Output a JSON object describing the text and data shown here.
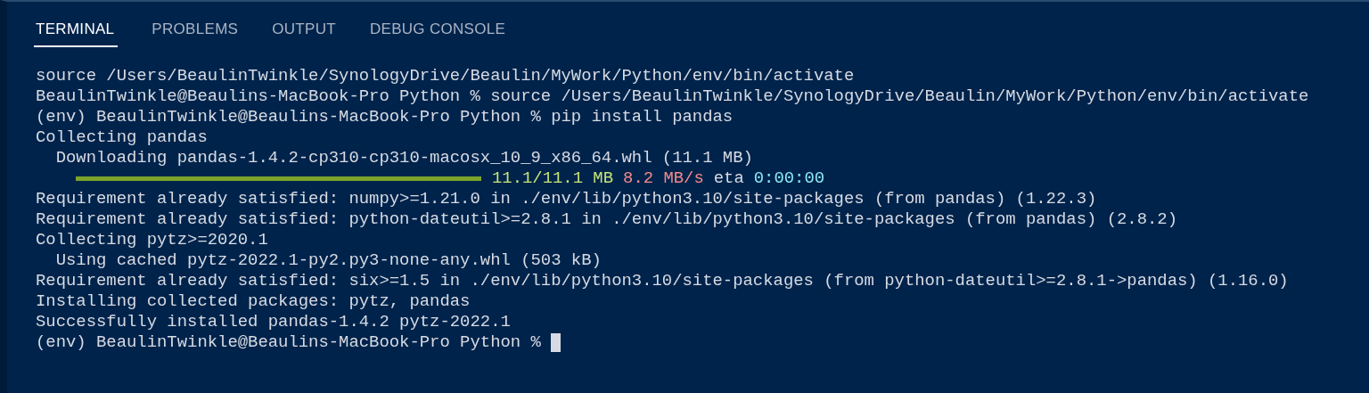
{
  "tabs": [
    {
      "label": "TERMINAL",
      "selected": true
    },
    {
      "label": "PROBLEMS",
      "selected": false
    },
    {
      "label": "OUTPUT",
      "selected": false
    },
    {
      "label": "DEBUG CONSOLE",
      "selected": false
    }
  ],
  "terminal": {
    "lines": [
      {
        "kind": "text",
        "text": "source /Users/BeaulinTwinkle/SynologyDrive/Beaulin/MyWork/Python/env/bin/activate"
      },
      {
        "kind": "text",
        "text": "BeaulinTwinkle@Beaulins-MacBook-Pro Python % source /Users/BeaulinTwinkle/SynologyDrive/Beaulin/MyWork/Python/env/bin/activate"
      },
      {
        "kind": "text",
        "text": "(env) BeaulinTwinkle@Beaulins-MacBook-Pro Python % pip install pandas"
      },
      {
        "kind": "text",
        "text": "Collecting pandas"
      },
      {
        "kind": "text",
        "text": "  Downloading pandas-1.4.2-cp310-cp310-macosx_10_9_x86_64.whl (11.1 MB)"
      },
      {
        "kind": "progress",
        "level": 1,
        "segments": [
          {
            "text": "11.1/11.1 MB",
            "color": "#c5e478"
          },
          {
            "text": "8.2 MB/s",
            "color": "#f48a8a"
          },
          {
            "text": "eta",
            "color": "#d6dbe3"
          },
          {
            "text": "0:00:00",
            "color": "#8ae8f4"
          }
        ]
      },
      {
        "kind": "text",
        "text": "Requirement already satisfied: numpy>=1.21.0 in ./env/lib/python3.10/site-packages (from pandas) (1.22.3)"
      },
      {
        "kind": "text",
        "text": "Requirement already satisfied: python-dateutil>=2.8.1 in ./env/lib/python3.10/site-packages (from pandas) (2.8.2)"
      },
      {
        "kind": "text",
        "text": "Collecting pytz>=2020.1"
      },
      {
        "kind": "text",
        "text": "  Using cached pytz-2022.1-py2.py3-none-any.whl (503 kB)"
      },
      {
        "kind": "text",
        "text": "Requirement already satisfied: six>=1.5 in ./env/lib/python3.10/site-packages (from python-dateutil>=2.8.1->pandas) (1.16.0)"
      },
      {
        "kind": "text",
        "text": "Installing collected packages: pytz, pandas"
      },
      {
        "kind": "text",
        "text": "Successfully installed pandas-1.4.2 pytz-2022.1"
      },
      {
        "kind": "prompt",
        "text": "(env) BeaulinTwinkle@Beaulins-MacBook-Pro Python %"
      }
    ]
  }
}
